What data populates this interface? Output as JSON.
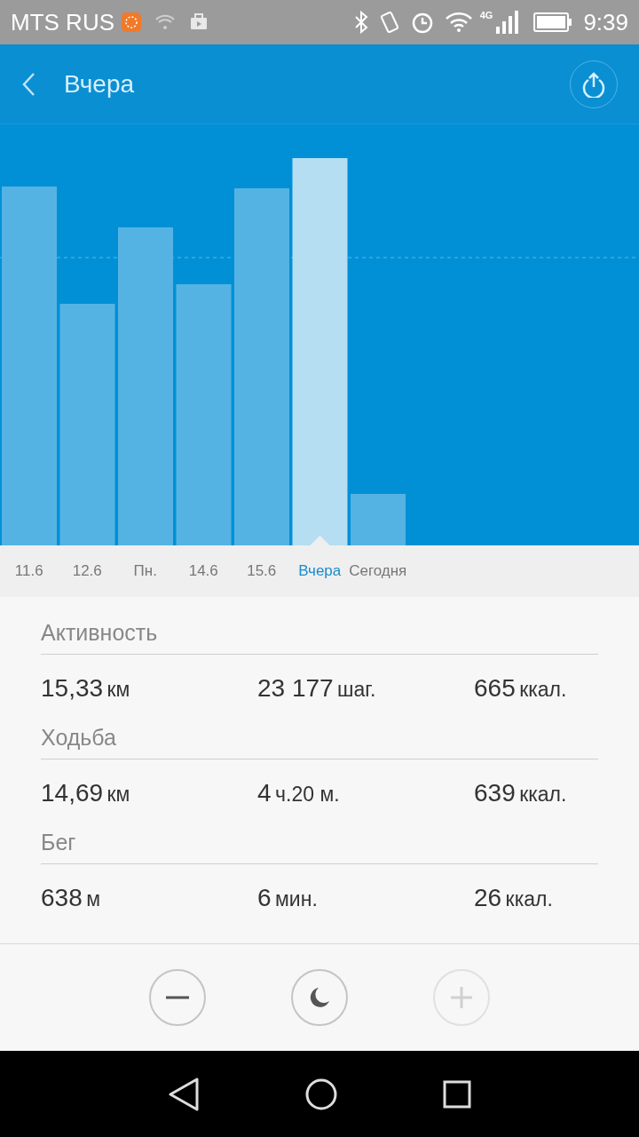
{
  "status_bar": {
    "carrier": "MTS RUS",
    "network_type": "4G",
    "time": "9:39"
  },
  "header": {
    "title": "Вчера"
  },
  "days": [
    {
      "label": "11.6",
      "selected": false
    },
    {
      "label": "12.6",
      "selected": false
    },
    {
      "label": "Пн.",
      "selected": false
    },
    {
      "label": "14.6",
      "selected": false
    },
    {
      "label": "15.6",
      "selected": false
    },
    {
      "label": "Вчера",
      "selected": true
    },
    {
      "label": "Сегодня",
      "selected": false
    }
  ],
  "sections": [
    {
      "title": "Активность",
      "values": [
        {
          "number": "15,33",
          "unit": "км"
        },
        {
          "number": "23 177",
          "unit": "шаг."
        },
        {
          "number": "665",
          "unit": "ккал."
        }
      ]
    },
    {
      "title": "Ходьба",
      "values": [
        {
          "number": "14,69",
          "unit": "км"
        },
        {
          "number": "4",
          "unit": "ч.20 м."
        },
        {
          "number": "639",
          "unit": "ккал."
        }
      ]
    },
    {
      "title": "Бег",
      "values": [
        {
          "number": "638",
          "unit": "м"
        },
        {
          "number": "6",
          "unit": "мин."
        },
        {
          "number": "26",
          "unit": "ккал."
        }
      ]
    }
  ],
  "buttons": [
    {
      "kind": "minus",
      "disabled": false
    },
    {
      "kind": "moon",
      "disabled": false
    },
    {
      "kind": "plus",
      "disabled": true
    }
  ]
}
